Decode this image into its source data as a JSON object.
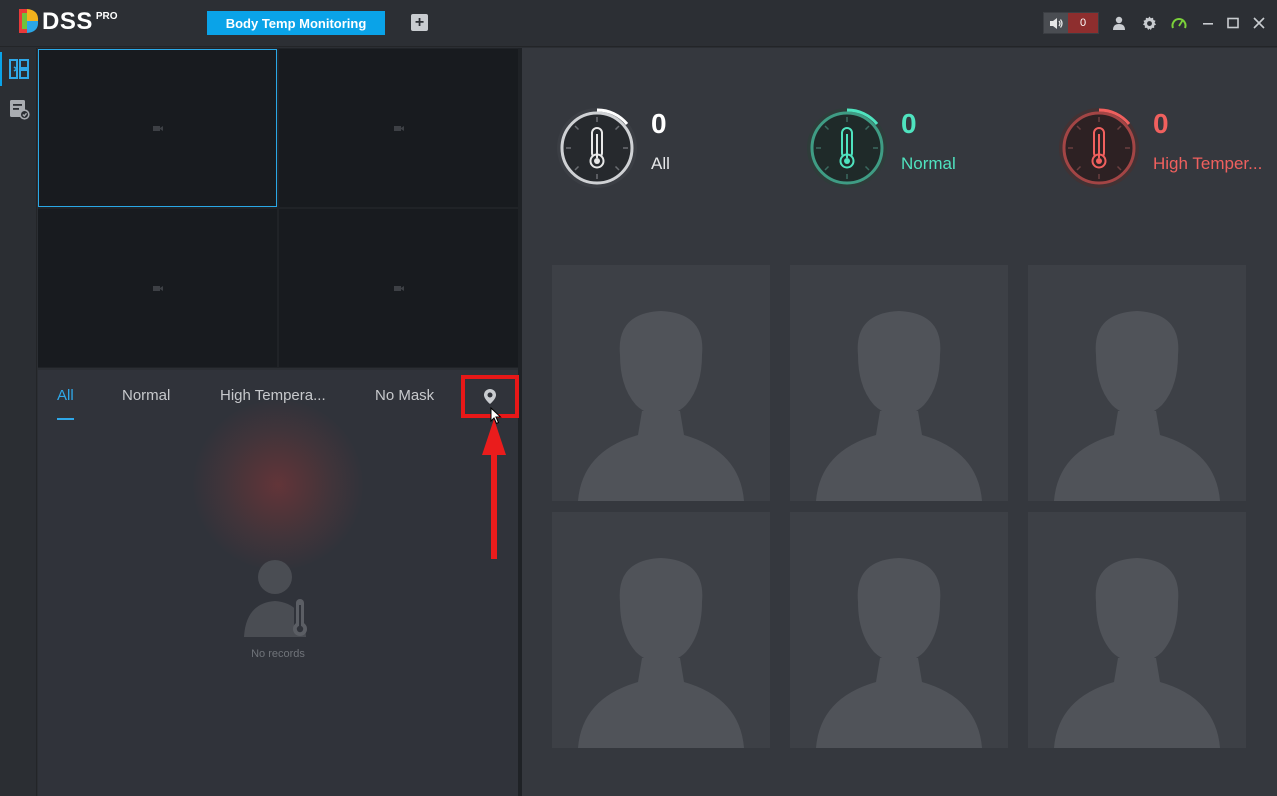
{
  "app": {
    "logo_text": "DSS",
    "logo_badge": "PRO",
    "active_tab": "Body Temp Monitoring",
    "add_tab_symbol": "+",
    "alarm_count": "0"
  },
  "icons": {
    "speaker": "speaker-icon",
    "user": "user-icon",
    "settings": "gear-icon",
    "performance": "speedometer-icon",
    "minimize": "minimize-icon",
    "maximize": "maximize-icon",
    "close": "close-icon",
    "live_view": "live-view-icon",
    "records": "records-icon",
    "locate": "location-pin-icon"
  },
  "colors": {
    "accent": "#0aa3e8",
    "normal": "#4fe3bf",
    "high": "#f0605e",
    "alarm_bg": "#8e2e2e",
    "highlight_box": "#e81818"
  },
  "records_panel": {
    "tabs": [
      {
        "label": "All"
      },
      {
        "label": "Normal"
      },
      {
        "label": "High Tempera..."
      },
      {
        "label": "No Mask"
      }
    ],
    "empty_text": "No records"
  },
  "stats": [
    {
      "count": "0",
      "label": "All"
    },
    {
      "count": "0",
      "label": "Normal"
    },
    {
      "count": "0",
      "label": "High Temper..."
    }
  ]
}
